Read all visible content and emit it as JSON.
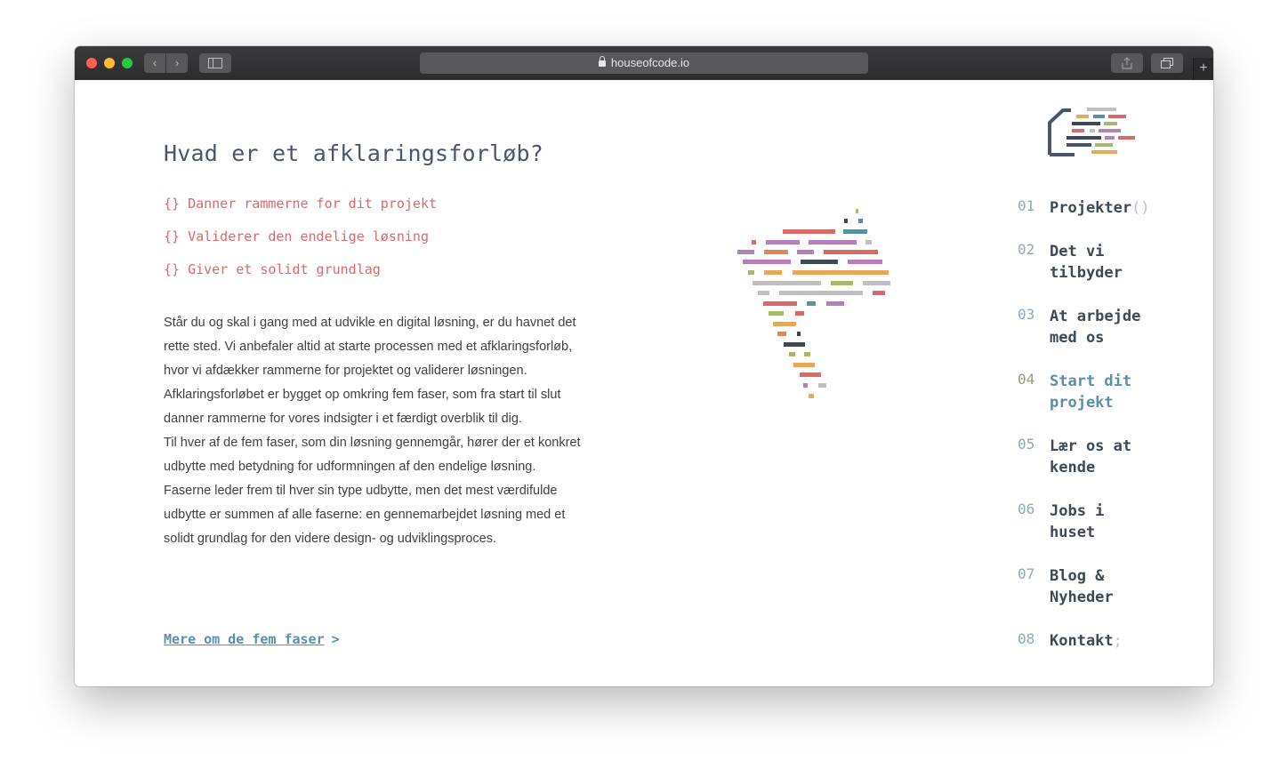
{
  "browser": {
    "url": "houseofcode.io"
  },
  "main": {
    "heading": "Hvad er et afklaringsforløb?",
    "bullets": [
      {
        "brace": "{}",
        "text": "Danner rammerne for dit projekt"
      },
      {
        "brace": "{}",
        "text": "Validerer den endelige løsning"
      },
      {
        "brace": "{}",
        "text": "Giver et solidt grundlag"
      }
    ],
    "paragraph1": "Står du og skal i gang med at udvikle en digital løsning, er du havnet det rette sted. Vi anbefaler altid at starte processen med et afklaringsforløb, hvor vi afdækker rammerne for projektet og validerer løsningen. Afklaringsforløbet er bygget op omkring fem faser, som fra start til slut danner rammerne for vores indsigter i et færdigt overblik til dig.",
    "paragraph2": "Til hver af de fem faser, som din løsning gennemgår, hører der et konkret udbytte med betydning for udformningen af den endelige løsning. Faserne leder frem til hver sin type udbytte, men det mest værdifulde udbytte er summen af alle faserne: en gennemarbejdet løsning med et solidt grundlag for den videre design- og udviklingsproces.",
    "more_link": "Mere om de fem faser",
    "more_arrow": ">"
  },
  "nav": {
    "items": [
      {
        "num": "01",
        "label": "Projekter",
        "tail": "()"
      },
      {
        "num": "02",
        "label": "Det vi tilbyder",
        "tail": ""
      },
      {
        "num": "03",
        "label": "At arbejde med os",
        "tail": ""
      },
      {
        "num": "04",
        "label": "Start dit projekt",
        "tail": ""
      },
      {
        "num": "05",
        "label": "Lær os at kende",
        "tail": ""
      },
      {
        "num": "06",
        "label": "Jobs i huset",
        "tail": ""
      },
      {
        "num": "07",
        "label": "Blog & Nyheder",
        "tail": ""
      },
      {
        "num": "08",
        "label": "Kontakt",
        "tail": ";"
      }
    ],
    "active_index": 3
  },
  "colors": {
    "accent_red": "#d96a6a",
    "accent_blue": "#5b8fa8",
    "text_dark": "#3d4a55"
  },
  "icons": {
    "logo": "house-of-code-logo",
    "illustration": "code-line-map-illustration"
  }
}
